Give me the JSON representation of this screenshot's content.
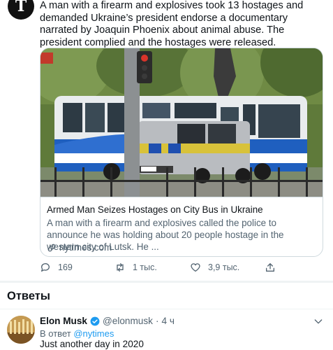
{
  "tweet": {
    "avatar_glyph": "T",
    "text": "A man with a firearm and explosives took 13 hostages and demanded Ukraine’s president endorse a documentary narrated by Joaquin Phoenix about animal abuse. The president complied and the hostages were released."
  },
  "card": {
    "title": "Armed Man Seizes Hostages on City Bus in Ukraine",
    "description": "A man with a firearm and explosives called the police to announce he was holding about 20 people hostage in the western city of Lutsk. He ...",
    "domain": "nytimes.com",
    "plate": "AI 0000 CC"
  },
  "actions": {
    "replies": "169",
    "retweets": "1 тыс.",
    "likes": "3,9 тыс."
  },
  "section_title": "Ответы",
  "reply": {
    "name": "Elon Musk",
    "handle": "@elonmusk",
    "separator": "·",
    "time": "4 ч",
    "reply_to_prefix": "В ответ",
    "reply_to_mention": "@nytimes",
    "text": "Just another day in 2020"
  },
  "colors": {
    "accent": "#1d9bf0",
    "muted": "#536471",
    "border": "#cfd9de"
  }
}
